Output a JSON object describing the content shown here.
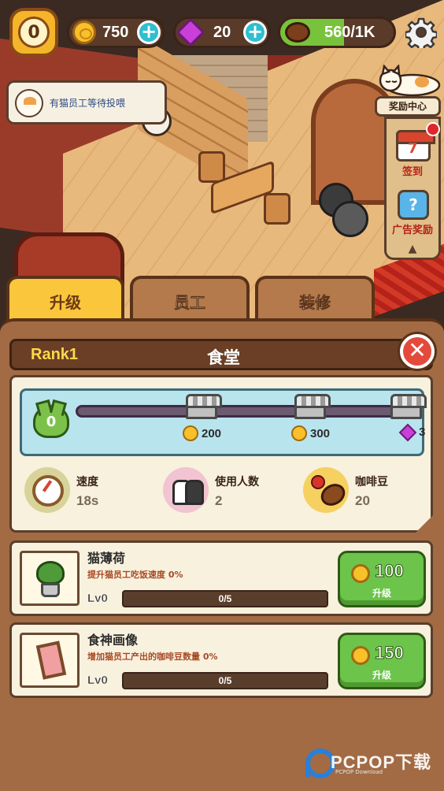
{
  "hud": {
    "level": "0",
    "coins": "750",
    "gems": "20",
    "beans": "560/1K",
    "beans_fill": 0.56
  },
  "notice": {
    "text": "有猫员工等待投喂"
  },
  "rewards": {
    "title": "奖励中心",
    "checkin_label": "签到",
    "calendar_day": "7",
    "ad_label": "广告奖励",
    "ad_icon": "?"
  },
  "tabs": [
    {
      "label": "升级",
      "active": true
    },
    {
      "label": "员工",
      "active": false
    },
    {
      "label": "装修",
      "active": false
    }
  ],
  "panel": {
    "rank": "Rank1",
    "title": "食堂",
    "level_badge": "0",
    "milestones": [
      {
        "icon": "shop-icon",
        "cost": "200",
        "currency": "coin"
      },
      {
        "icon": "shop-icon",
        "cost": "300",
        "currency": "coin"
      },
      {
        "icon": "shop-icon",
        "cost": "3",
        "currency": "gem"
      }
    ],
    "stats": [
      {
        "label": "速度",
        "value": "18s",
        "icon": "clock-icon"
      },
      {
        "label": "使用人数",
        "value": "2",
        "icon": "cats-icon"
      },
      {
        "label": "咖啡豆",
        "value": "20",
        "icon": "coffee-bean-icon"
      }
    ]
  },
  "items": [
    {
      "name": "猫薄荷",
      "desc": "提升猫员工吃饭速度 0%",
      "level": "Lv0",
      "progress": "0/5",
      "progress_fraction": 0,
      "cost": "100",
      "button_label": "升级",
      "icon": "catnip-plant-icon"
    },
    {
      "name": "食神画像",
      "desc": "增加猫员工产出的咖啡豆数量 0%",
      "level": "Lv0",
      "progress": "0/5",
      "progress_fraction": 0,
      "cost": "150",
      "button_label": "升级",
      "icon": "portrait-frame-icon"
    }
  ],
  "watermark": {
    "text": "PCPOP下载",
    "sub": "PCPOP Download"
  }
}
